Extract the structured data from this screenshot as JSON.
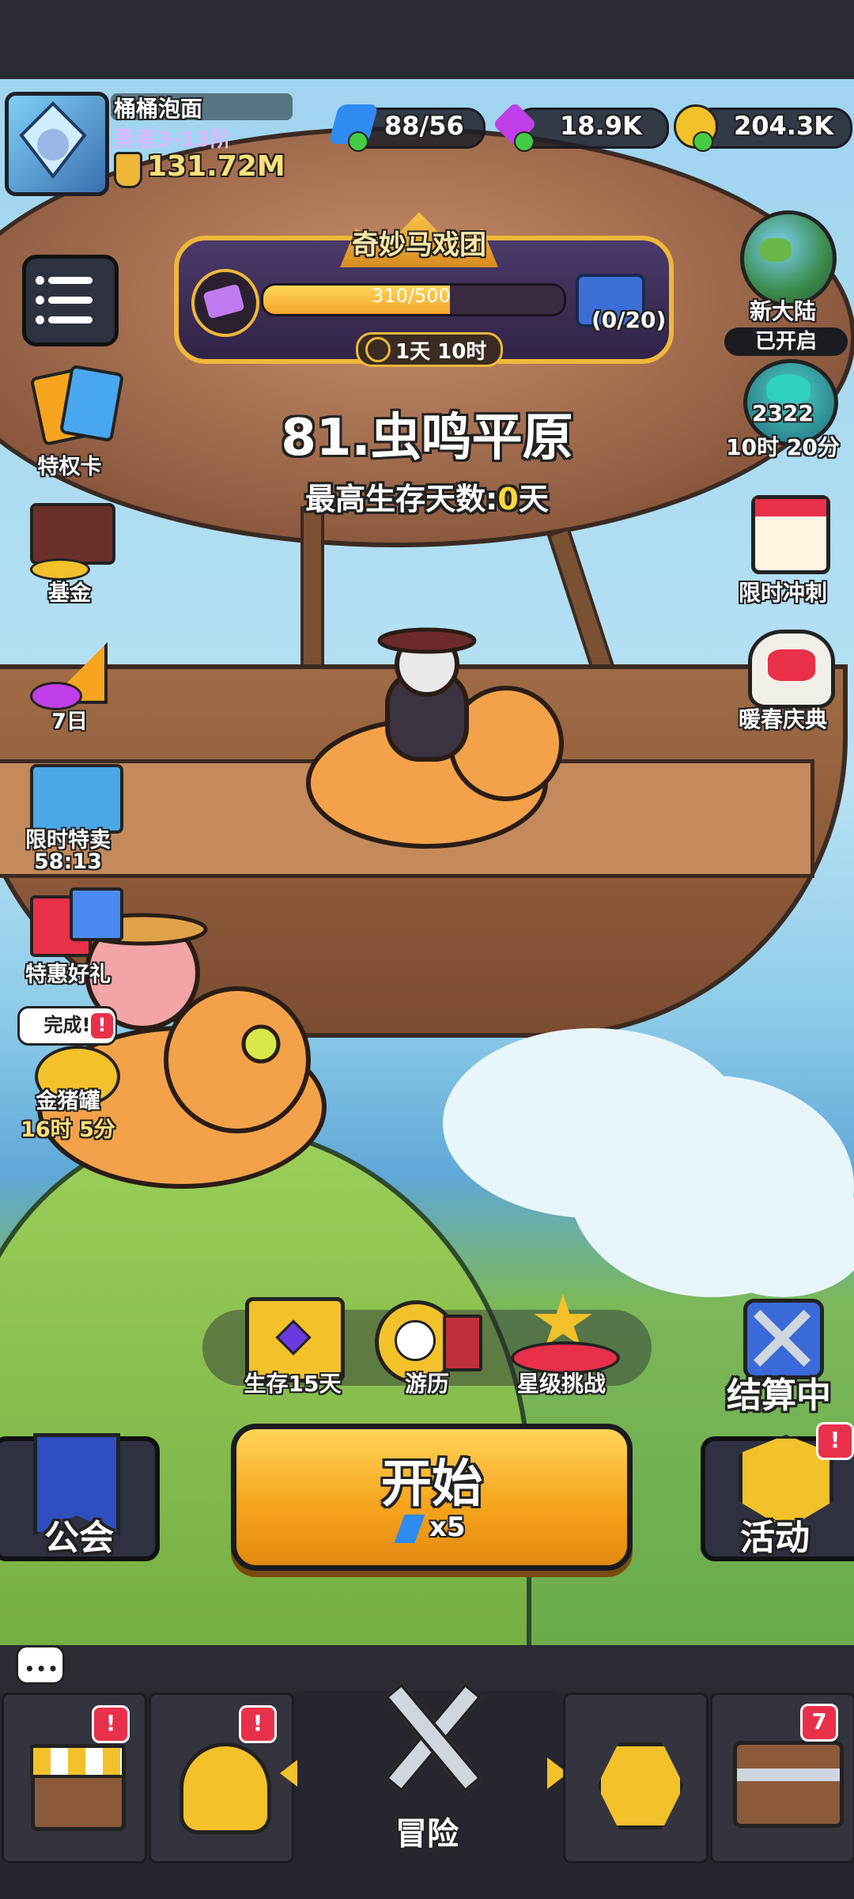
{
  "player": {
    "name": "桶桶泡面",
    "rank": "勇者3-13阶",
    "power": "131.72M"
  },
  "resources": {
    "energy": "88/56",
    "gems": "18.9K",
    "coins": "204.3K"
  },
  "event": {
    "title": "奇妙马戏团",
    "progress_text": "310/500",
    "progress_fraction": 0.62,
    "reward_count": "(0/20)",
    "timer": "1天 10时"
  },
  "stage": {
    "name": "81.虫鸣平原",
    "best_label": "最高生存天数:",
    "best_value": "0",
    "best_unit": "天"
  },
  "left_menu": [
    {
      "label": "特权卡",
      "icon": "privilege-card-icon"
    },
    {
      "label": "基金",
      "icon": "fund-chart-icon"
    },
    {
      "label": "7日",
      "icon": "seven-day-party-icon"
    },
    {
      "label": "限时特卖",
      "sub": "58:13",
      "icon": "limited-sale-icon"
    },
    {
      "label": "特惠好礼",
      "icon": "gift-box-icon"
    },
    {
      "label": "金猪罐",
      "sub": "16时 5分",
      "bubble": "完成!",
      "icon": "golden-pig-icon"
    }
  ],
  "right_menu": [
    {
      "label": "新大陆",
      "sub": "已开启",
      "icon": "planet-icon"
    },
    {
      "label": "2322",
      "sub": "10时 20分",
      "icon": "mushroom-icon"
    },
    {
      "label": "限时冲刺",
      "icon": "calendar-sprint-icon"
    },
    {
      "label": "暖春庆典",
      "icon": "lion-dance-icon"
    }
  ],
  "quick_actions": [
    {
      "label": "生存15天",
      "icon": "treasure-chest-icon"
    },
    {
      "label": "游历",
      "icon": "compass-icon"
    },
    {
      "label": "星级挑战",
      "icon": "star-challenge-icon"
    }
  ],
  "settlement": {
    "label": "结算中",
    "icon": "crossed-swords-icon"
  },
  "start_button": {
    "label": "开始",
    "cost": "x5"
  },
  "guild": {
    "label": "公会"
  },
  "activity": {
    "label": "活动",
    "badge": "!"
  },
  "bottom_nav": [
    {
      "name": "shop",
      "label": "",
      "badge": "!"
    },
    {
      "name": "equipment",
      "label": "",
      "badge": "!"
    },
    {
      "name": "adventure",
      "label": "冒险",
      "badge": ""
    },
    {
      "name": "upgrade",
      "label": "",
      "badge": ""
    },
    {
      "name": "chest",
      "label": "",
      "badge": "7"
    }
  ],
  "colors": {
    "accent_orange": "#f7a51e",
    "badge_red": "#e8304a",
    "gold_border": "#f0b73a",
    "best_value_yellow": "#ffd83a"
  }
}
